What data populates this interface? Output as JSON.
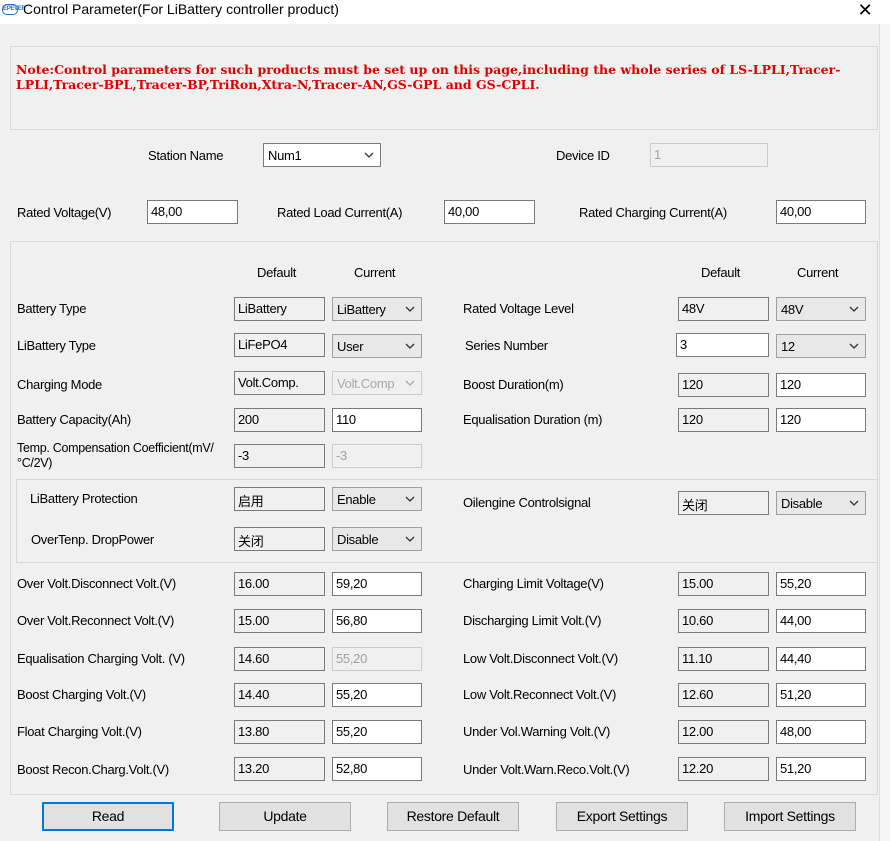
{
  "window": {
    "title": "Control Parameter(For LiBattery controller product)",
    "app_icon_text": "EPEVER",
    "close_glyph": "✕"
  },
  "note": "Note:Control parameters for such products must be set up on this page,including the whole series of LS-LPLI,Tracer-LPLI,Tracer-BPL,Tracer-BP,TriRon,Xtra-N,Tracer-AN,GS-GPL and GS-CPLI.",
  "station": {
    "label": "Station Name",
    "value": "Num1"
  },
  "device": {
    "label": "Device ID",
    "value": "1"
  },
  "rated": {
    "voltage_label": "Rated Voltage(V)",
    "voltage_value": "48,00",
    "load_label": "Rated Load Current(A)",
    "load_value": "40,00",
    "charging_label": "Rated Charging Current(A)",
    "charging_value": "40,00"
  },
  "headers": {
    "default": "Default",
    "current": "Current"
  },
  "left_params": [
    {
      "label": "Battery Type",
      "default": "LiBattery",
      "current": "LiBattery"
    },
    {
      "label": "LiBattery Type",
      "default": "LiFePO4",
      "current": "User"
    },
    {
      "label": "Charging Mode",
      "default": "Volt.Comp.",
      "current": "Volt.Comp"
    },
    {
      "label": "Battery Capacity(Ah)",
      "default": "200",
      "current": "110"
    },
    {
      "label": "Temp. Compensation Coefficient(mV/°C/2V)",
      "default": "-3",
      "current": "-3"
    }
  ],
  "right_params": [
    {
      "label": "Rated Voltage Level",
      "default": "48V",
      "current": "48V"
    },
    {
      "label": "Series Number",
      "default": "3",
      "current": "12"
    },
    {
      "label": "Boost Duration(m)",
      "default": "120",
      "current": "120"
    },
    {
      "label": "Equalisation Duration (m)",
      "default": "120",
      "current": "120"
    }
  ],
  "protection": {
    "libattery_label": "LiBattery Protection",
    "libattery_default": "启用",
    "libattery_current": "Enable",
    "overtemp_label": "OverTenp. DropPower",
    "overtemp_default": "关闭",
    "overtemp_current": "Disable",
    "oil_label": "Oilengine Controlsignal",
    "oil_default": "关闭",
    "oil_current": "Disable"
  },
  "voltages_left": [
    {
      "label": "Over Volt.Disconnect Volt.(V)",
      "default": "16.00",
      "current": "59,20"
    },
    {
      "label": "Over Volt.Reconnect Volt.(V)",
      "default": "15.00",
      "current": "56,80"
    },
    {
      "label": "Equalisation Charging Volt. (V)",
      "default": "14.60",
      "current": "55,20"
    },
    {
      "label": "Boost Charging Volt.(V)",
      "default": "14.40",
      "current": "55,20"
    },
    {
      "label": "Float Charging Volt.(V)",
      "default": "13.80",
      "current": "55,20"
    },
    {
      "label": "Boost Recon.Charg.Volt.(V)",
      "default": "13.20",
      "current": "52,80"
    }
  ],
  "voltages_right": [
    {
      "label": "Charging Limit Voltage(V)",
      "default": "15.00",
      "current": "55,20"
    },
    {
      "label": "Discharging Limit Volt.(V)",
      "default": "10.60",
      "current": "44,00"
    },
    {
      "label": "Low Volt.Disconnect Volt.(V)",
      "default": "11.10",
      "current": "44,40"
    },
    {
      "label": "Low Volt.Reconnect Volt.(V)",
      "default": "12.60",
      "current": "51,20"
    },
    {
      "label": "Under Vol.Warning Volt.(V)",
      "default": "12.00",
      "current": "48,00"
    },
    {
      "label": "Under Volt.Warn.Reco.Volt.(V)",
      "default": "12.20",
      "current": "51,20"
    }
  ],
  "buttons": {
    "read": "Read",
    "update": "Update",
    "restore": "Restore Default",
    "export": "Export Settings",
    "import": "Import Settings"
  }
}
